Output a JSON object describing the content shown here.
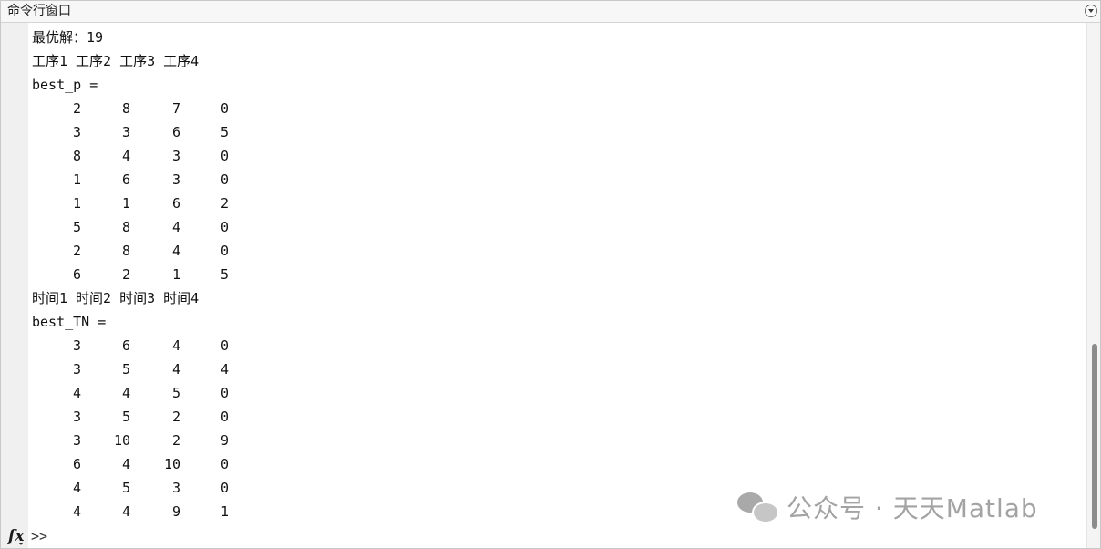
{
  "window": {
    "title": "命令行窗口"
  },
  "output": {
    "best_line": "最优解：19",
    "process_header": "工序1 工序2 工序3 工序4",
    "best_p_label": "best_p =",
    "best_p": [
      [
        "2",
        "8",
        "7",
        "0"
      ],
      [
        "3",
        "3",
        "6",
        "5"
      ],
      [
        "8",
        "4",
        "3",
        "0"
      ],
      [
        "1",
        "6",
        "3",
        "0"
      ],
      [
        "1",
        "1",
        "6",
        "2"
      ],
      [
        "5",
        "8",
        "4",
        "0"
      ],
      [
        "2",
        "8",
        "4",
        "0"
      ],
      [
        "6",
        "2",
        "1",
        "5"
      ]
    ],
    "time_header": "时间1 时间2 时间3 时间4",
    "best_tn_label": "best_TN =",
    "best_tn": [
      [
        "3",
        "6",
        "4",
        "0"
      ],
      [
        "3",
        "5",
        "4",
        "4"
      ],
      [
        "4",
        "4",
        "5",
        "0"
      ],
      [
        "3",
        "5",
        "2",
        "0"
      ],
      [
        "3",
        "10",
        "2",
        "9"
      ],
      [
        "6",
        "4",
        "10",
        "0"
      ],
      [
        "4",
        "5",
        "3",
        "0"
      ],
      [
        "4",
        "4",
        "9",
        "1"
      ]
    ]
  },
  "prompt": {
    "fx_label": "fx",
    "symbol": ">>"
  },
  "watermark": {
    "text": "公众号 · 天天Matlab"
  }
}
